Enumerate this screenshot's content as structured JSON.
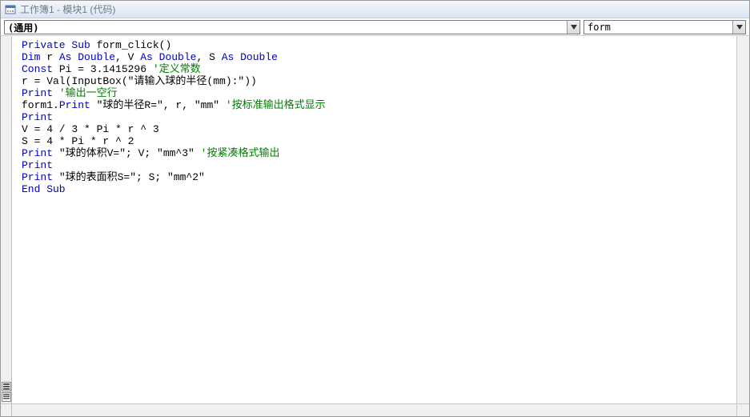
{
  "window": {
    "title": "工作簿1 - 模块1 (代码)"
  },
  "dropdowns": {
    "left": "(通用)",
    "right": "form"
  },
  "code": {
    "lines": [
      {
        "segments": [
          {
            "t": "Private Sub",
            "c": "kw"
          },
          {
            "t": " form_click()",
            "c": ""
          }
        ]
      },
      {
        "segments": [
          {
            "t": "Dim",
            "c": "kw"
          },
          {
            "t": " r ",
            "c": ""
          },
          {
            "t": "As Double",
            "c": "kw"
          },
          {
            "t": ", V ",
            "c": ""
          },
          {
            "t": "As Double",
            "c": "kw"
          },
          {
            "t": ", S ",
            "c": ""
          },
          {
            "t": "As Double",
            "c": "kw"
          }
        ]
      },
      {
        "segments": [
          {
            "t": "Const",
            "c": "kw"
          },
          {
            "t": " Pi = 3.1415296 ",
            "c": ""
          },
          {
            "t": "'定义常数",
            "c": "cm"
          }
        ]
      },
      {
        "segments": [
          {
            "t": "r = Val(InputBox(\"请输入球的半径(mm):\"))",
            "c": ""
          }
        ]
      },
      {
        "segments": [
          {
            "t": "Print",
            "c": "kw"
          },
          {
            "t": " ",
            "c": ""
          },
          {
            "t": "'输出一空行",
            "c": "cm"
          }
        ]
      },
      {
        "segments": [
          {
            "t": "form1.",
            "c": ""
          },
          {
            "t": "Print",
            "c": "kw"
          },
          {
            "t": " \"球的半径R=\", r, \"mm\" ",
            "c": ""
          },
          {
            "t": "'按标准输出格式显示",
            "c": "cm"
          }
        ]
      },
      {
        "segments": [
          {
            "t": "Print",
            "c": "kw"
          }
        ]
      },
      {
        "segments": [
          {
            "t": "V = 4 / 3 * Pi * r ^ 3",
            "c": ""
          }
        ]
      },
      {
        "segments": [
          {
            "t": "S = 4 * Pi * r ^ 2",
            "c": ""
          }
        ]
      },
      {
        "segments": [
          {
            "t": "Print",
            "c": "kw"
          },
          {
            "t": " \"球的体积V=\"; V; \"mm^3\" ",
            "c": ""
          },
          {
            "t": "'按紧凑格式输出",
            "c": "cm"
          }
        ]
      },
      {
        "segments": [
          {
            "t": "Print",
            "c": "kw"
          }
        ]
      },
      {
        "segments": [
          {
            "t": "Print",
            "c": "kw"
          },
          {
            "t": " \"球的表面积S=\"; S; \"mm^2\"",
            "c": ""
          }
        ]
      },
      {
        "segments": [
          {
            "t": "End Sub",
            "c": "kw"
          }
        ]
      }
    ]
  }
}
